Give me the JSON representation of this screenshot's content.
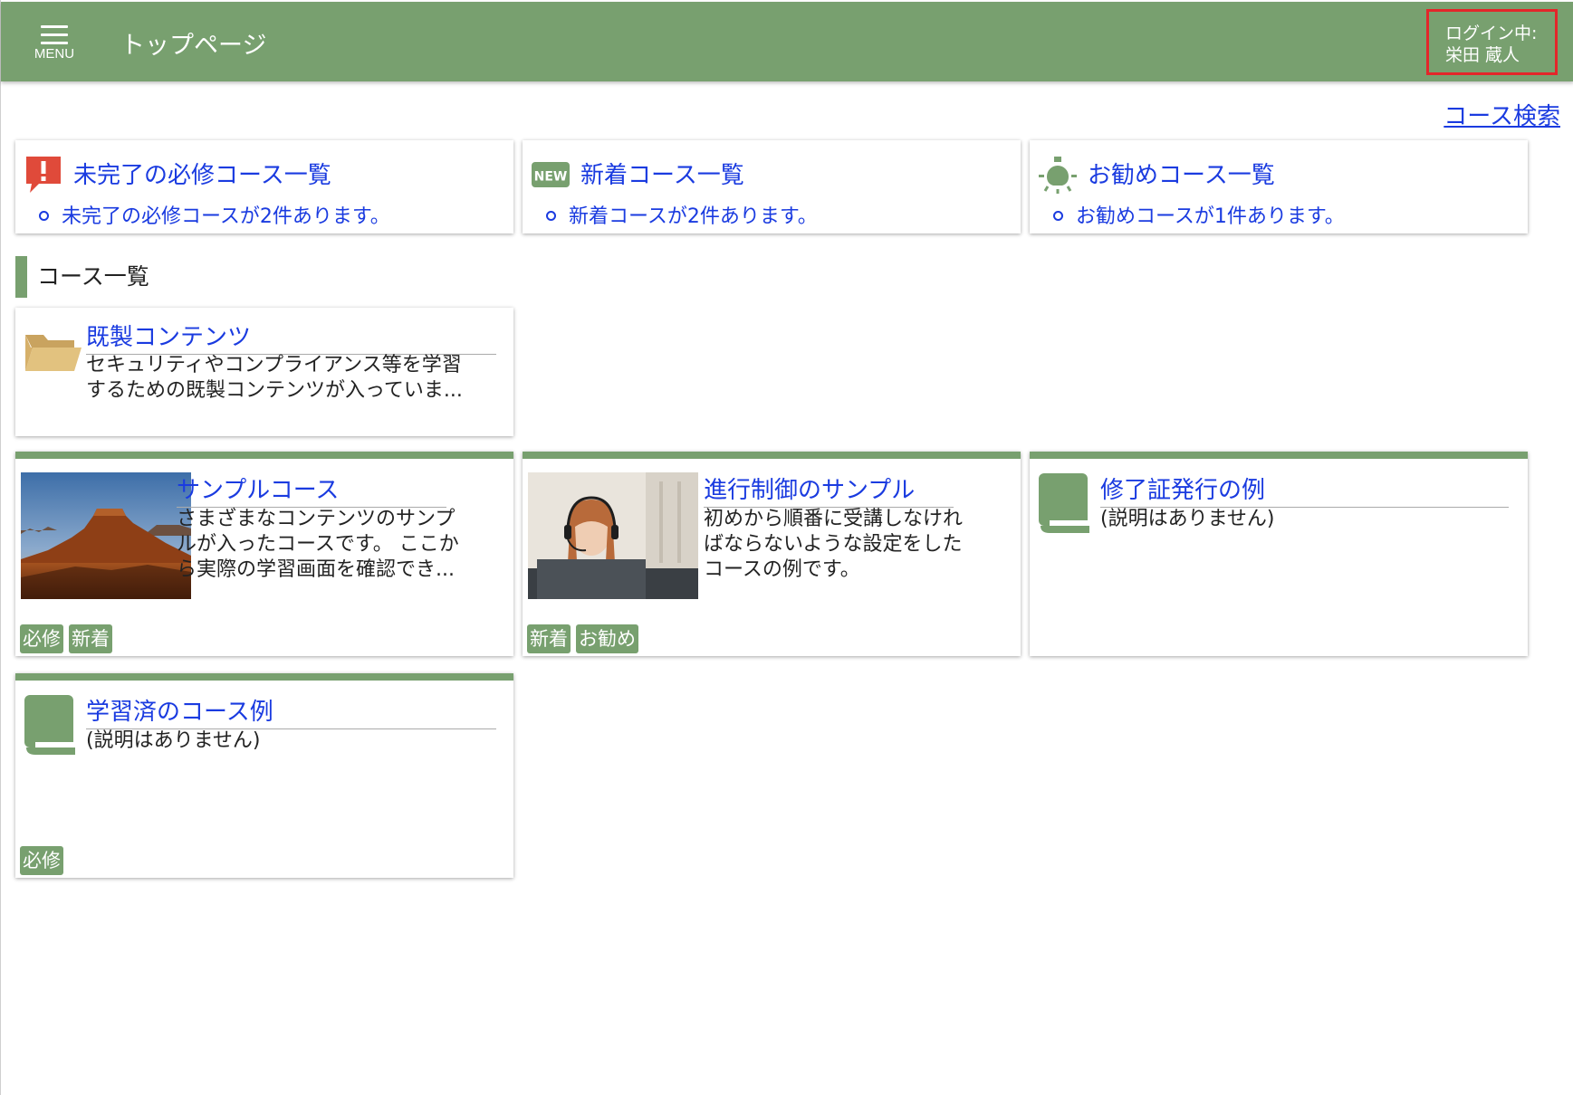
{
  "header": {
    "menu_label": "MENU",
    "title": "トップページ",
    "login_label": "ログイン中:",
    "user_name": "栄田 蔵人"
  },
  "links": {
    "course_search": "コース検索"
  },
  "summary": [
    {
      "icon": "alert-icon",
      "title": "未完了の必修コース一覧",
      "item": "未完了の必修コースが2件あります。"
    },
    {
      "icon": "new-badge-icon",
      "title": "新着コース一覧",
      "item": "新着コースが2件あります。"
    },
    {
      "icon": "lightbulb-icon",
      "title": "お勧めコース一覧",
      "item": "お勧めコースが1件あります。"
    }
  ],
  "section": {
    "course_list_heading": "コース一覧"
  },
  "folder": {
    "icon": "folder-icon",
    "title": "既製コンテンツ",
    "description_line1": "セキュリティやコンプライアンス等を学習",
    "description_line2": "するための既製コンテンツが入っていま..."
  },
  "courses": [
    {
      "title": "サンプルコース",
      "image": "desert-landscape-image",
      "description_lines": [
        "さまざまなコンテンツのサンプ",
        "ルが入ったコースです。 ここか",
        "ら実際の学習画面を確認でき..."
      ],
      "tags": [
        "必修",
        "新着"
      ]
    },
    {
      "title": "進行制御のサンプル",
      "image": "headset-woman-image",
      "description_lines": [
        "初めから順番に受講しなけれ",
        "ばならないような設定をした",
        "コースの例です。"
      ],
      "tags": [
        "新着",
        "お勧め"
      ]
    },
    {
      "title": "修了証発行の例",
      "icon": "book-icon",
      "description_lines": [
        "(説明はありません)"
      ],
      "tags": []
    },
    {
      "title": "学習済のコース例",
      "icon": "book-icon",
      "description_lines": [
        "(説明はありません)"
      ],
      "tags": [
        "必修"
      ]
    }
  ],
  "colors": {
    "header_green": "#78a06f",
    "link_blue": "#1a3be0",
    "login_border_red": "#e3262a",
    "alert_red": "#e04a3a",
    "folder_tan": "#e2c27f"
  }
}
